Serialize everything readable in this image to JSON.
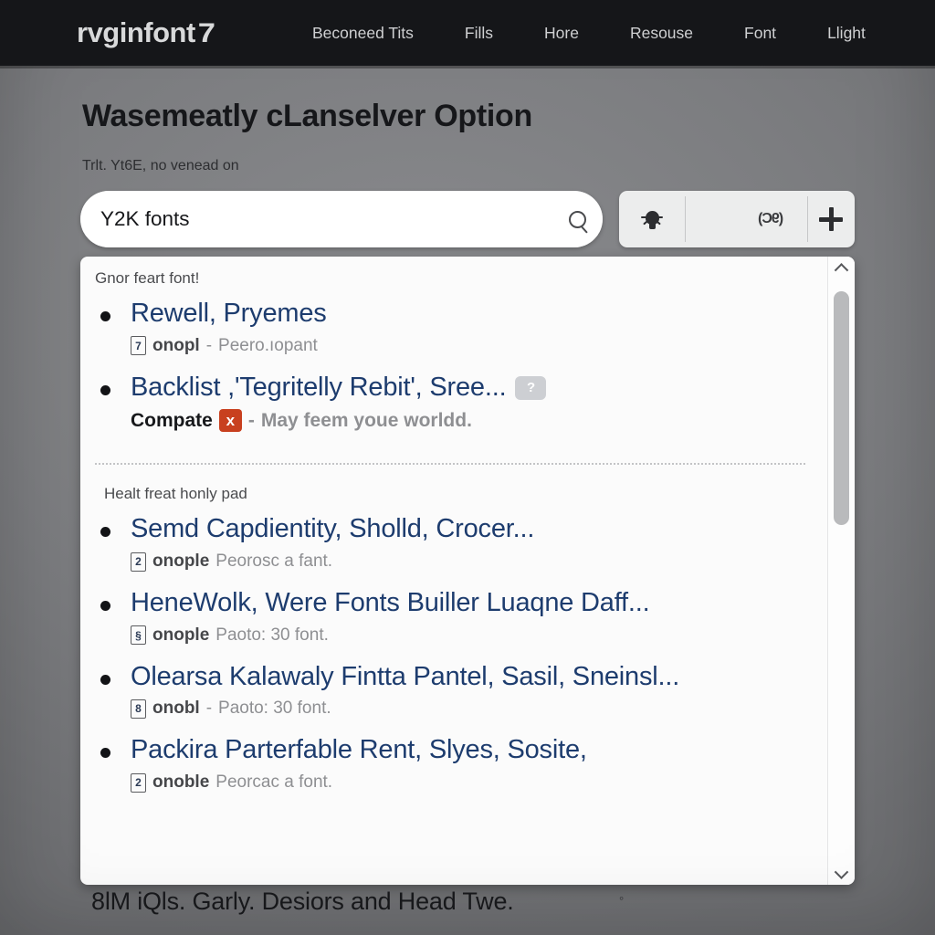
{
  "topnav": {
    "brand": "rvginfont",
    "brand_mark": "7",
    "links": [
      {
        "label": "Beconeed Tits"
      },
      {
        "label": "Fills"
      },
      {
        "label": "Hore"
      },
      {
        "label": "Resouse"
      },
      {
        "label": "Font"
      },
      {
        "label": "Llight"
      }
    ]
  },
  "header": {
    "title": "Wasemeatly cLanselver Option",
    "subtitle": "Trlt. Yt6E, no venead on"
  },
  "search": {
    "value": "Y2K fonts",
    "placeholder": "Y2K fonts",
    "icon": "search-icon"
  },
  "toolbar": {
    "bulb_icon": "lightbulb-icon",
    "window_icon": "monitor-icon",
    "window_code": "(9C)",
    "plus_icon": "plus-icon"
  },
  "results": {
    "sections": [
      {
        "label": "Gnor feart font!",
        "items": [
          {
            "title": "Rewell, Pryemes",
            "badge": "",
            "sub_badge": "7",
            "sub_strong": "onopl",
            "sub_dash": "-",
            "sub_text": "Peero.ıopant",
            "extra_row": ""
          },
          {
            "title": "Backlist ,'Tegritelly Rebit', Sree...",
            "badge": "?",
            "sub_badge": "",
            "sub_strong": "Compate",
            "sub_dash": "-",
            "sub_text": "May feem youe worldd.",
            "extra_row": "x"
          }
        ]
      },
      {
        "label": "Healt freat honly pad",
        "items": [
          {
            "title": "Semd Capdientity, Sholld, Crocer...",
            "badge": "",
            "sub_badge": "2",
            "sub_strong": "onople",
            "sub_dash": "",
            "sub_text": "Peorosc a fant.",
            "extra_row": ""
          },
          {
            "title": "HeneWolk, Were Fonts Builler Luaqne Daff...",
            "badge": "",
            "sub_badge": "§",
            "sub_strong": "onople",
            "sub_dash": "",
            "sub_text": "Paoto: 30 font.",
            "extra_row": ""
          },
          {
            "title": "Olearsa Kalawaly Fintta Pantel, Sasil, Sneinsl...",
            "badge": "",
            "sub_badge": "8",
            "sub_strong": "onobl",
            "sub_dash": "-",
            "sub_text": "Paoto: 30 font.",
            "extra_row": ""
          },
          {
            "title": "Packira Parterfable Rent, Slyes, Sosite,",
            "badge": "",
            "sub_badge": "2",
            "sub_strong": "onoble",
            "sub_dash": "",
            "sub_text": "Peorcac a font.",
            "extra_row": ""
          }
        ]
      }
    ]
  },
  "scrollbar": {
    "up_icon": "chevron-up-icon",
    "down_icon": "chevron-down-icon"
  },
  "footer": {
    "text": "8lM iQls. Garly. Desiors and Head Twe.",
    "trailing_mark": "°"
  },
  "colors": {
    "nav_bg": "#151619",
    "page_bg": "#7c7d80",
    "link_blue": "#1d3c6e",
    "danger": "#c8401f",
    "badge_gray": "#cdcfd3"
  }
}
